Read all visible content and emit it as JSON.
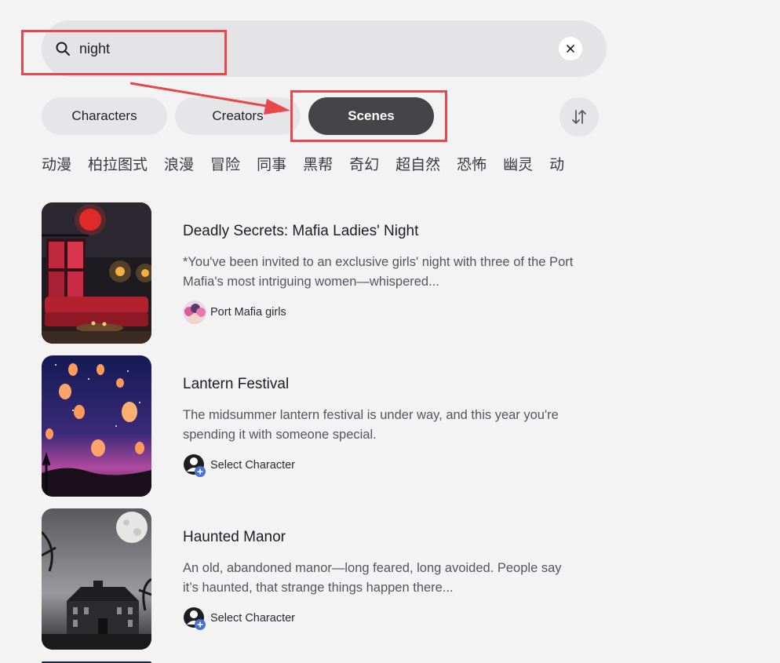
{
  "search": {
    "value": "night"
  },
  "tabs": [
    {
      "label": "Characters",
      "selected": false
    },
    {
      "label": "Creators",
      "selected": false
    },
    {
      "label": "Scenes",
      "selected": true
    }
  ],
  "genres": [
    "动漫",
    "柏拉图式",
    "浪漫",
    "冒险",
    "同事",
    "黑帮",
    "奇幻",
    "超自然",
    "恐怖",
    "幽灵",
    "动"
  ],
  "results": [
    {
      "title": "Deadly Secrets: Mafia Ladies' Night",
      "description": "*You've been invited to an exclusive girls' night with three of the Port Mafia's most intriguing women—whispered...",
      "meta_label": "Port Mafia girls",
      "meta_icon": "group-avatar-icon"
    },
    {
      "title": "Lantern Festival",
      "description": "The midsummer lantern festival is under way, and this year you're spending it with someone special.",
      "meta_label": "Select Character",
      "meta_icon": "select-character-icon"
    },
    {
      "title": "Haunted Manor",
      "description": "An old, abandoned manor—long feared, long avoided. People say it’s haunted, that strange things happen there...",
      "meta_label": "Select Character",
      "meta_icon": "select-character-icon"
    }
  ],
  "icons": {
    "search": "search-icon",
    "clear": "close-icon",
    "sort": "sort-arrows-icon"
  },
  "colors": {
    "background": "#f3f3f4",
    "active_tab": "#454547",
    "annotation": "#e8474b",
    "select_badge": "#4a6fd6"
  }
}
